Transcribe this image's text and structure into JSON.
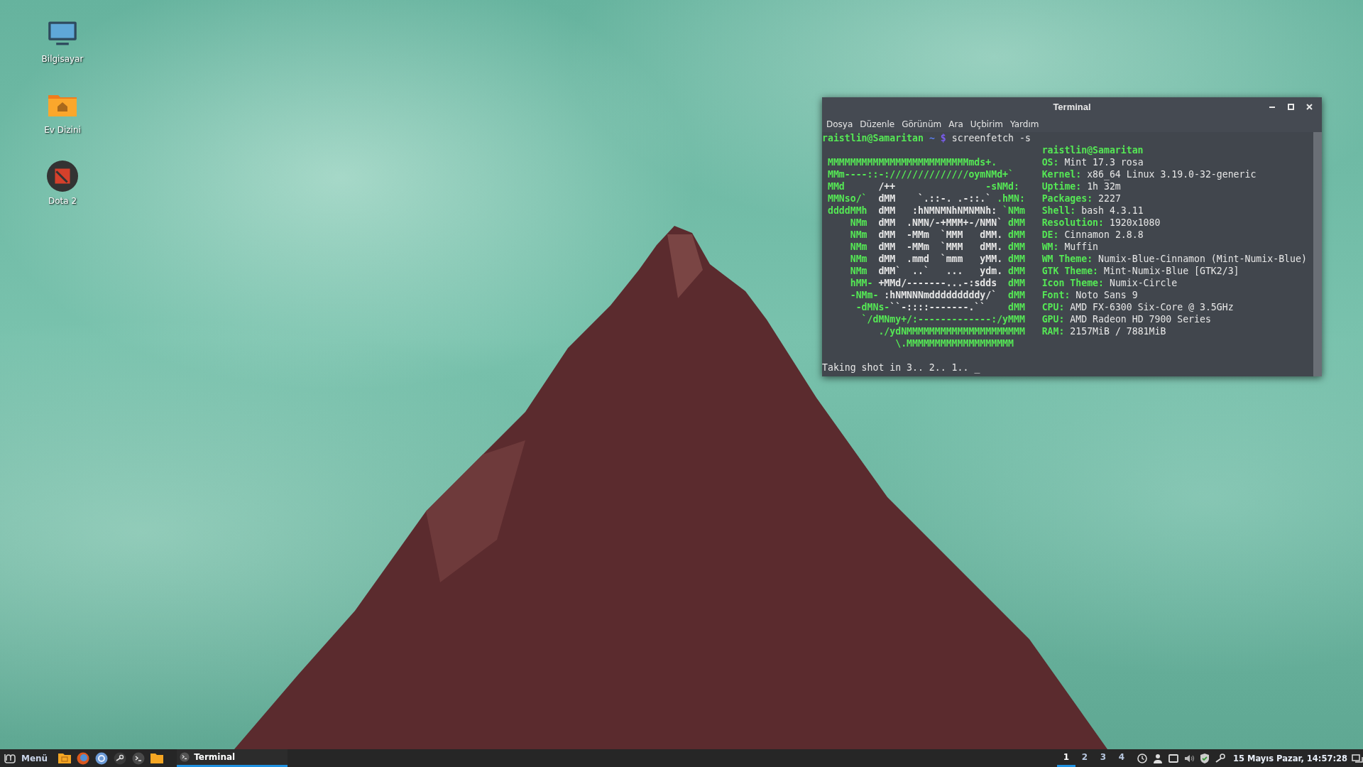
{
  "desktop_icons": [
    {
      "label": "Bilgisayar",
      "kind": "monitor"
    },
    {
      "label": "Ev Dizini",
      "kind": "home-folder"
    },
    {
      "label": "Dota 2",
      "kind": "game"
    }
  ],
  "terminal": {
    "title": "Terminal",
    "menu": [
      "Dosya",
      "Düzenle",
      "Görünüm",
      "Ara",
      "Uçbirim",
      "Yardım"
    ],
    "prompt": {
      "user_host": "raistlin@Samaritan",
      "path": "~",
      "symbol": "$",
      "command": "screenfetch -s"
    },
    "art": [
      {
        "segments": [
          {
            "text": " MMMMMMMMMMMMMMMMMMMMMMMMMmds+.",
            "color": "#55e855"
          }
        ]
      },
      {
        "segments": [
          {
            "text": " MMm----::-://////////////oymNMd+`",
            "color": "#55e855"
          }
        ]
      },
      {
        "segments": [
          {
            "text": " MMd      ",
            "color": "#55e855"
          },
          {
            "text": "/++                ",
            "color": "#e6e6e6"
          },
          {
            "text": "-sNMd:",
            "color": "#55e855"
          }
        ]
      },
      {
        "segments": [
          {
            "text": " MMNso/`  ",
            "color": "#55e855"
          },
          {
            "text": "dMM    `.::-. .-::.` ",
            "color": "#e6e6e6"
          },
          {
            "text": ".hMN:",
            "color": "#55e855"
          }
        ]
      },
      {
        "segments": [
          {
            "text": " ddddMMh  ",
            "color": "#55e855"
          },
          {
            "text": "dMM   :hNMNMNhNMNMNh: ",
            "color": "#e6e6e6"
          },
          {
            "text": "`NMm",
            "color": "#55e855"
          }
        ]
      },
      {
        "segments": [
          {
            "text": "     NMm  ",
            "color": "#55e855"
          },
          {
            "text": "dMM  .NMN/-+MMM+-/NMN` ",
            "color": "#e6e6e6"
          },
          {
            "text": "dMM",
            "color": "#55e855"
          }
        ]
      },
      {
        "segments": [
          {
            "text": "     NMm  ",
            "color": "#55e855"
          },
          {
            "text": "dMM  -MMm  `MMM   dMM. ",
            "color": "#e6e6e6"
          },
          {
            "text": "dMM",
            "color": "#55e855"
          }
        ]
      },
      {
        "segments": [
          {
            "text": "     NMm  ",
            "color": "#55e855"
          },
          {
            "text": "dMM  -MMm  `MMM   dMM. ",
            "color": "#e6e6e6"
          },
          {
            "text": "dMM",
            "color": "#55e855"
          }
        ]
      },
      {
        "segments": [
          {
            "text": "     NMm  ",
            "color": "#55e855"
          },
          {
            "text": "dMM  .mmd  `mmm   yMM. ",
            "color": "#e6e6e6"
          },
          {
            "text": "dMM",
            "color": "#55e855"
          }
        ]
      },
      {
        "segments": [
          {
            "text": "     NMm  ",
            "color": "#55e855"
          },
          {
            "text": "dMM`  ..`   ...   ydm. ",
            "color": "#e6e6e6"
          },
          {
            "text": "dMM",
            "color": "#55e855"
          }
        ]
      },
      {
        "segments": [
          {
            "text": "     hMM- ",
            "color": "#55e855"
          },
          {
            "text": "+MMd/-------...-:sdds  ",
            "color": "#e6e6e6"
          },
          {
            "text": "dMM",
            "color": "#55e855"
          }
        ]
      },
      {
        "segments": [
          {
            "text": "     -NMm- ",
            "color": "#55e855"
          },
          {
            "text": ":hNMNNNmdddddddddy/`  ",
            "color": "#e6e6e6"
          },
          {
            "text": "dMM",
            "color": "#55e855"
          }
        ]
      },
      {
        "segments": [
          {
            "text": "      -dMNs-",
            "color": "#55e855"
          },
          {
            "text": "``-::::-------.``    ",
            "color": "#e6e6e6"
          },
          {
            "text": "dMM",
            "color": "#55e855"
          }
        ]
      },
      {
        "segments": [
          {
            "text": "       `/dMNmy+/:-------------:/yMMM",
            "color": "#55e855"
          }
        ]
      },
      {
        "segments": [
          {
            "text": "          ./ydNMMMMMMMMMMMMMMMMMMMMM",
            "color": "#55e855"
          }
        ]
      },
      {
        "segments": [
          {
            "text": "             \\.MMMMMMMMMMMMMMMMMMM",
            "color": "#55e855"
          }
        ]
      }
    ],
    "info_title": "raistlin@Samaritan",
    "info": [
      {
        "label": "OS:",
        "value": "Mint 17.3 rosa"
      },
      {
        "label": "Kernel:",
        "value": "x86_64 Linux 3.19.0-32-generic"
      },
      {
        "label": "Uptime:",
        "value": "1h 32m"
      },
      {
        "label": "Packages:",
        "value": "2227"
      },
      {
        "label": "Shell:",
        "value": "bash 4.3.11"
      },
      {
        "label": "Resolution:",
        "value": "1920x1080"
      },
      {
        "label": "DE:",
        "value": "Cinnamon 2.8.8"
      },
      {
        "label": "WM:",
        "value": "Muffin"
      },
      {
        "label": "WM Theme:",
        "value": "Numix-Blue-Cinnamon (Mint-Numix-Blue)"
      },
      {
        "label": "GTK Theme:",
        "value": "Mint-Numix-Blue [GTK2/3]"
      },
      {
        "label": "Icon Theme:",
        "value": "Numix-Circle"
      },
      {
        "label": "Font:",
        "value": "Noto Sans 9"
      },
      {
        "label": "CPU:",
        "value": "AMD FX-6300 Six-Core @ 3.5GHz"
      },
      {
        "label": "GPU:",
        "value": "AMD Radeon HD 7900 Series"
      },
      {
        "label": "RAM:",
        "value": "2157MiB / 7881MiB"
      }
    ],
    "last_line": "Taking shot in 3.. 2.. 1.. ",
    "cursor": "_"
  },
  "taskbar": {
    "menu_label": "Menü",
    "launchers": [
      {
        "kind": "files"
      },
      {
        "kind": "globe"
      },
      {
        "kind": "ring"
      },
      {
        "kind": "link"
      },
      {
        "kind": "terminal"
      },
      {
        "kind": "folder"
      }
    ],
    "windows": [
      {
        "label": "Terminal",
        "selected": true
      }
    ],
    "workspaces": [
      {
        "label": "1",
        "selected": true
      },
      {
        "label": "2",
        "selected": false
      },
      {
        "label": "3",
        "selected": false
      },
      {
        "label": "4",
        "selected": false
      }
    ],
    "tray": [
      {
        "kind": "clock"
      },
      {
        "kind": "user"
      },
      {
        "kind": "display"
      },
      {
        "kind": "speaker"
      },
      {
        "kind": "shield"
      },
      {
        "kind": "link"
      }
    ],
    "clock": "15 Mayıs Pazar, 14:57:28"
  }
}
